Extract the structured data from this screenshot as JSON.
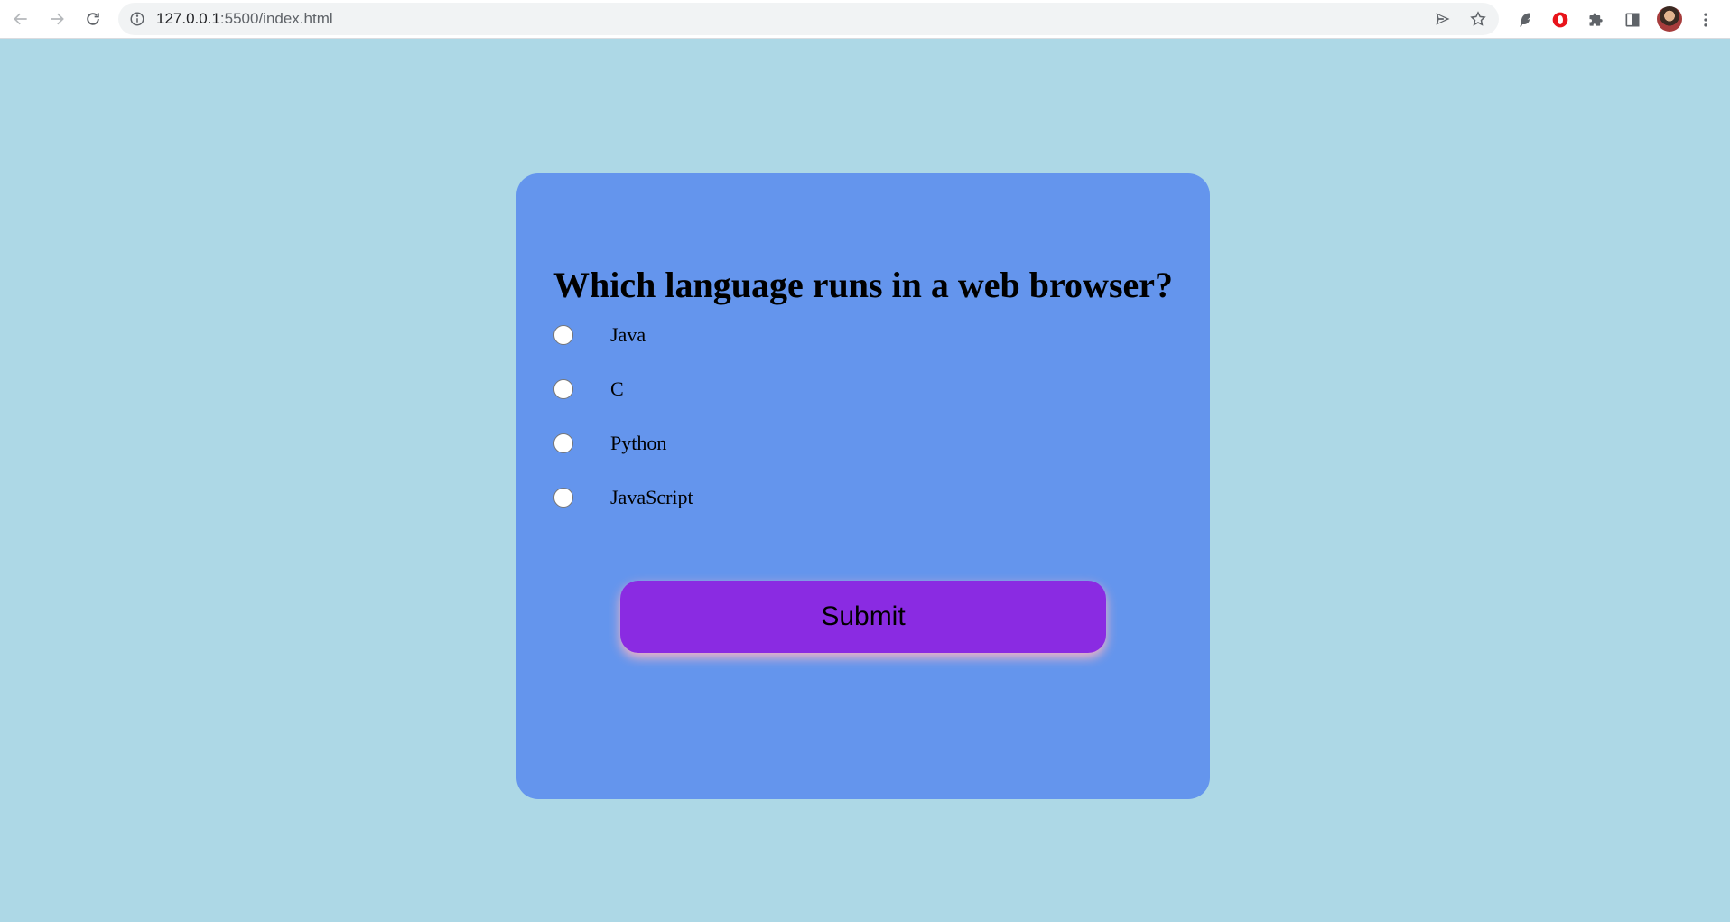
{
  "browser": {
    "url_host": "127.0.0.1",
    "url_path": ":5500/index.html",
    "icons": {
      "back": "back-arrow-icon",
      "forward": "forward-arrow-icon",
      "reload": "reload-icon",
      "site_info": "info-icon",
      "send": "send-icon",
      "bookmark": "star-icon",
      "extension_1": "feather-extension-icon",
      "extension_2": "opera-extension-icon",
      "extensions": "puzzle-icon",
      "side_panel": "side-panel-icon",
      "menu": "kebab-menu-icon"
    }
  },
  "quiz": {
    "question": "Which language runs in a web browser?",
    "options": [
      {
        "label": "Java",
        "selected": false
      },
      {
        "label": "C",
        "selected": false
      },
      {
        "label": "Python",
        "selected": false
      },
      {
        "label": "JavaScript",
        "selected": false
      }
    ],
    "submit_label": "Submit"
  },
  "colors": {
    "page_background": "#add8e6",
    "card_background": "#6495ed",
    "button_background": "#8a2be2",
    "button_glow": "#ffb6c1"
  }
}
